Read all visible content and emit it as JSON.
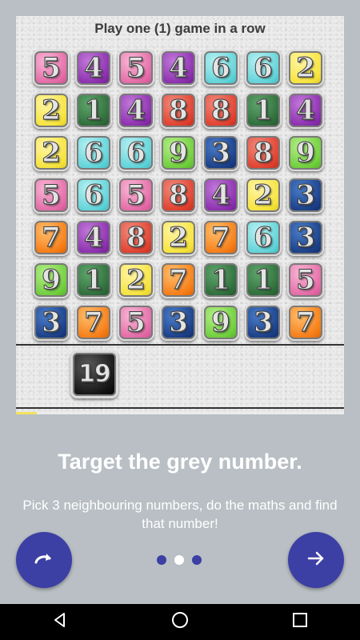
{
  "board": {
    "banner": "Play one (1) game in a row",
    "grid": [
      [
        {
          "n": "5",
          "c": "pink"
        },
        {
          "n": "4",
          "c": "purple"
        },
        {
          "n": "5",
          "c": "pink"
        },
        {
          "n": "4",
          "c": "purple"
        },
        {
          "n": "6",
          "c": "cyan"
        },
        {
          "n": "6",
          "c": "cyan"
        },
        {
          "n": "2",
          "c": "yellow"
        }
      ],
      [
        {
          "n": "2",
          "c": "yellow"
        },
        {
          "n": "1",
          "c": "green"
        },
        {
          "n": "4",
          "c": "purple"
        },
        {
          "n": "8",
          "c": "red"
        },
        {
          "n": "8",
          "c": "red"
        },
        {
          "n": "1",
          "c": "green"
        },
        {
          "n": "4",
          "c": "purple"
        }
      ],
      [
        {
          "n": "2",
          "c": "yellow"
        },
        {
          "n": "6",
          "c": "cyan"
        },
        {
          "n": "6",
          "c": "cyan"
        },
        {
          "n": "9",
          "c": "lime"
        },
        {
          "n": "3",
          "c": "navy"
        },
        {
          "n": "8",
          "c": "red"
        },
        {
          "n": "9",
          "c": "lime"
        }
      ],
      [
        {
          "n": "5",
          "c": "pink"
        },
        {
          "n": "6",
          "c": "cyan"
        },
        {
          "n": "5",
          "c": "pink"
        },
        {
          "n": "8",
          "c": "red"
        },
        {
          "n": "4",
          "c": "purple"
        },
        {
          "n": "2",
          "c": "yellow"
        },
        {
          "n": "3",
          "c": "navy"
        }
      ],
      [
        {
          "n": "7",
          "c": "orange"
        },
        {
          "n": "4",
          "c": "purple"
        },
        {
          "n": "8",
          "c": "red"
        },
        {
          "n": "2",
          "c": "yellow"
        },
        {
          "n": "7",
          "c": "orange"
        },
        {
          "n": "6",
          "c": "cyan"
        },
        {
          "n": "3",
          "c": "navy"
        }
      ],
      [
        {
          "n": "9",
          "c": "lime"
        },
        {
          "n": "1",
          "c": "green"
        },
        {
          "n": "2",
          "c": "yellow"
        },
        {
          "n": "7",
          "c": "orange"
        },
        {
          "n": "1",
          "c": "green"
        },
        {
          "n": "1",
          "c": "green"
        },
        {
          "n": "5",
          "c": "pink"
        }
      ],
      [
        {
          "n": "3",
          "c": "navy"
        },
        {
          "n": "7",
          "c": "orange"
        },
        {
          "n": "5",
          "c": "pink"
        },
        {
          "n": "3",
          "c": "navy"
        },
        {
          "n": "9",
          "c": "lime"
        },
        {
          "n": "3",
          "c": "navy"
        },
        {
          "n": "7",
          "c": "orange"
        }
      ]
    ],
    "target": "19"
  },
  "onboarding": {
    "headline": "Target the grey number.",
    "subtext": "Pick 3 neighbouring numbers, do the maths and find that number!",
    "page_total": 3,
    "page_active": 2,
    "left_button_icon": "redo-icon",
    "right_button_icon": "arrow-right-icon"
  },
  "navbar": {
    "icons": [
      "back-triangle-icon",
      "home-circle-icon",
      "recents-square-icon"
    ]
  },
  "colors": {
    "accent": "#3c3fa3",
    "background": "#b9bfc4",
    "text": "#ffffff"
  }
}
